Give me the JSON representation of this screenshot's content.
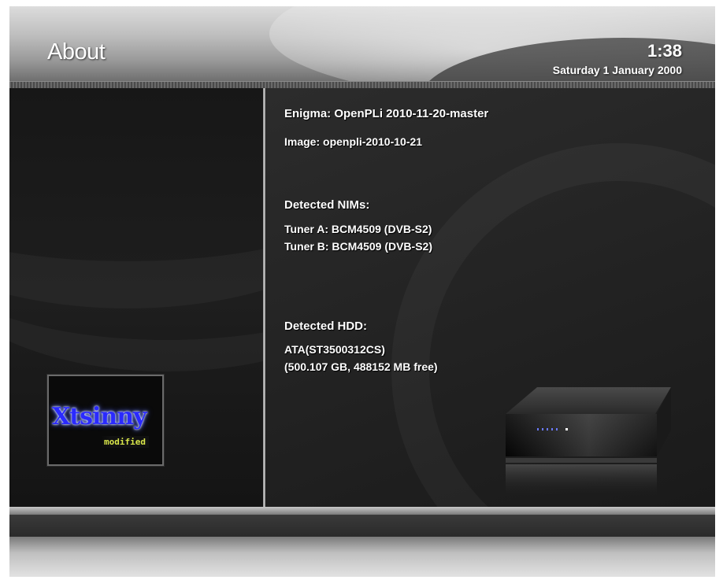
{
  "header": {
    "title": "About",
    "time": "1:38",
    "date": "Saturday 1 January 2000"
  },
  "about": {
    "enigma": "Enigma: OpenPLi 2010-11-20-master",
    "image": "Image: openpli-2010-10-21",
    "nims_heading": "Detected NIMs:",
    "tuners": [
      "Tuner A: BCM4509 (DVB-S2)",
      "Tuner B: BCM4509 (DVB-S2)"
    ],
    "hdd_heading": "Detected HDD:",
    "hdd_model": "ATA(ST3500312CS)",
    "hdd_capacity": "(500.107 GB, 488152 MB free)"
  },
  "logo": {
    "text": "Xtsinny",
    "subtext": "modified"
  },
  "colors": {
    "background": "#1b1b1b",
    "header_light": "#dcdcdc",
    "text": "#ffffff",
    "logo_blue": "#2a2aff",
    "logo_yellow": "#d9e64a"
  },
  "icons": {
    "device": "receiver-device-icon"
  }
}
